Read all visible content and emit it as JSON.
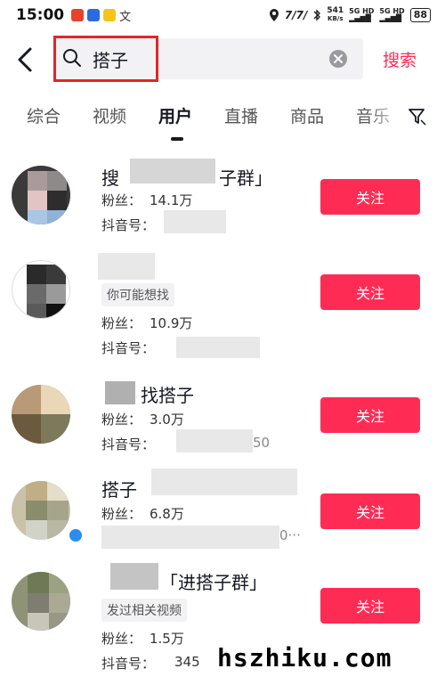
{
  "status_bar": {
    "time": "15:00",
    "net_speed_value": "541",
    "net_speed_unit": "KB/s",
    "sim1": "5G HD",
    "sim2": "5G HD",
    "battery": "88"
  },
  "search": {
    "query": "搭子",
    "submit_label": "搜索"
  },
  "tabs": [
    {
      "label": "综合",
      "active": false
    },
    {
      "label": "视频",
      "active": false
    },
    {
      "label": "用户",
      "active": true
    },
    {
      "label": "直播",
      "active": false
    },
    {
      "label": "商品",
      "active": false
    },
    {
      "label": "音乐",
      "active": false
    }
  ],
  "users": [
    {
      "name_prefix": "搜",
      "name_suffix": "子群」",
      "tag": "",
      "fans_label": "粉丝：",
      "fans": "14.1万",
      "id_label": "抖音号：",
      "id_suffix": "",
      "follow_label": "关注"
    },
    {
      "name_prefix": "",
      "name_suffix": "",
      "tag": "你可能想找",
      "fans_label": "粉丝：",
      "fans": "10.9万",
      "id_label": "抖音号：",
      "id_suffix": "",
      "follow_label": "关注"
    },
    {
      "name_prefix": "",
      "name_suffix": "找搭子",
      "tag": "",
      "fans_label": "粉丝：",
      "fans": "3.0万",
      "id_label": "抖音号：",
      "id_suffix": "50",
      "follow_label": "关注"
    },
    {
      "name_prefix": "搭子",
      "name_suffix": "",
      "tag": "",
      "fans_label": "粉丝：",
      "fans": "6.8万",
      "id_label": "",
      "id_suffix": "0···",
      "follow_label": "关注"
    },
    {
      "name_prefix": "",
      "name_suffix": "「进搭子群」",
      "tag": "发过相关视频",
      "fans_label": "粉丝：",
      "fans": "1.5万",
      "id_label": "抖音号：",
      "id_suffix": "345",
      "follow_label": "关注"
    }
  ],
  "watermark": "hszhiku.com",
  "colors": {
    "accent": "#fe2c55",
    "highlight_box": "#e0262b"
  }
}
